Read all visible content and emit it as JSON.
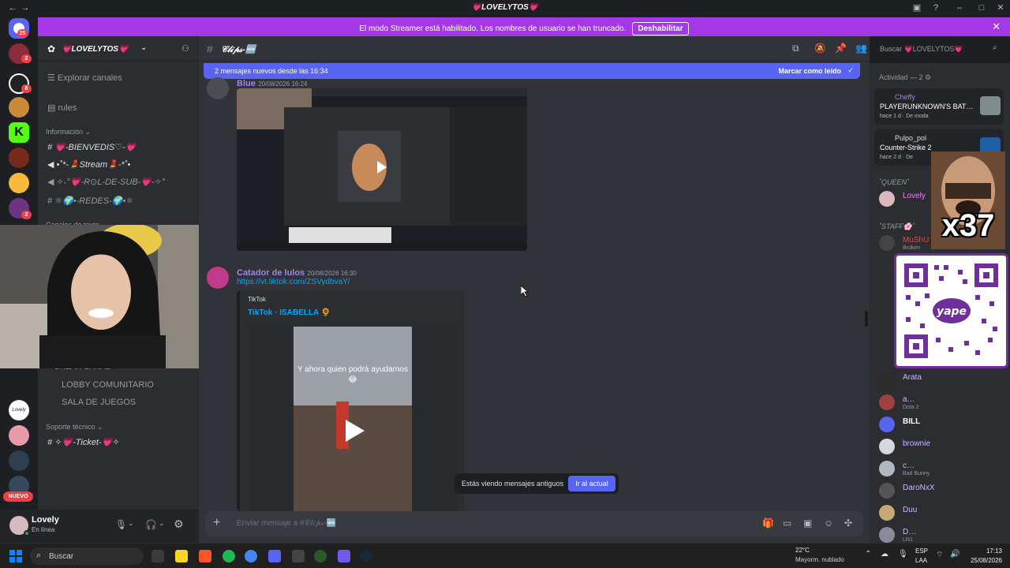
{
  "window": {
    "title": "💗LOVELYTOS💗"
  },
  "banner": {
    "text": "El modo Streamer está habilitado. Los nombres de usuario se han truncado.",
    "button": "Deshabilitar"
  },
  "rail": {
    "badges": [
      "25",
      "2",
      "8",
      "2"
    ],
    "new_label": "NUEVO",
    "new_tooltip": "Lovely"
  },
  "sidebar": {
    "server_name": "💗LOVELYTOS💗",
    "top_items": [
      "Explorar canales",
      "rules"
    ],
    "category_info": "Información",
    "channels": [
      "💗-BIENVEDIS♡-💗",
      "•˚*-💄Stream💄-*˚•",
      "✧˖°💗-R⊙L-DE-SUB-💗-✧°",
      "⚛🌍•-REDES-🌍•⚛"
    ],
    "category_text": "Canales de texto",
    "channels2": [
      "✦CREAR CANAL",
      "LOBBY COMUNITARIO",
      "SALA DE JUEGOS"
    ],
    "category_support": "Soporte técnico",
    "ticket": "✧💗-Ticket-💗✧"
  },
  "user": {
    "name": "Lovely",
    "status": "En línea"
  },
  "chat": {
    "channel": "𝒞𝓁𝒾𝓅𝓈-🆕",
    "new_messages": "2 mensajes nuevos desde las 16:34",
    "mark_read": "Marcar como leído",
    "msg1": {
      "author": "Blue",
      "time": "20/08/2026 16:24"
    },
    "msg2": {
      "author": "Catador de lulos",
      "time": "20/08/2026 16:30",
      "link": "https://vt.tiktok.com/ZSVydbvaY/"
    },
    "embed": {
      "provider": "TikTok",
      "title": "TikTok · ISABELLA 🌻",
      "caption": "Y ahora quien podrá ayudarnos 😂"
    },
    "old_notice": "Estás viendo mensajes antiguos",
    "jump": "Ir al actual",
    "composer_placeholder": "Enviar mensaje a #𝒞𝓁𝒾𝓅𝓈-🆕",
    "search_placeholder": "Buscar 💗LOVELYTOS💗"
  },
  "members": {
    "activity_header": "Actividad — 2",
    "activities": [
      {
        "user": "Cheffy",
        "game": "PLAYERUNKNOWN'S BAT…",
        "meta": "hace 1 d",
        "tag": "De moda"
      },
      {
        "user": "Pulpo_pol",
        "game": "Counter-Strike 2",
        "meta": "hace 2 d",
        "tag": "De"
      }
    ],
    "role_queen": "˚QUEEN˚",
    "role_staff": "˚STAFF🌸˚",
    "list": [
      {
        "name": "Lovely",
        "sub": "",
        "color": "#f47fff"
      },
      {
        "name": "MuShU",
        "sub": "Broken",
        "color": "#f23f43"
      },
      {
        "name": "Arata",
        "sub": "",
        "color": "#c9b8ff"
      },
      {
        "name": "a…",
        "sub": "Dota 2",
        "color": "#c9b8ff"
      },
      {
        "name": "BILL",
        "sub": "",
        "color": "#c9b8ff"
      },
      {
        "name": "brownie",
        "sub": "",
        "color": "#c9b8ff"
      },
      {
        "name": "c…",
        "sub": "Bad Bunny",
        "color": "#c9b8ff"
      },
      {
        "name": "DaroNxX",
        "sub": "",
        "color": "#c9b8ff"
      },
      {
        "name": "Duu",
        "sub": "",
        "color": "#c9b8ff"
      },
      {
        "name": "D…",
        "sub": "LN1",
        "color": "#c9b8ff"
      }
    ],
    "overlay_count": "x37"
  },
  "taskbar": {
    "search": "Buscar",
    "weather_temp": "22°C",
    "weather_desc": "Mayorm. nublado",
    "lang": "ESP",
    "lang2": "LAA",
    "time": "17:13",
    "date": "25/08/2026"
  }
}
